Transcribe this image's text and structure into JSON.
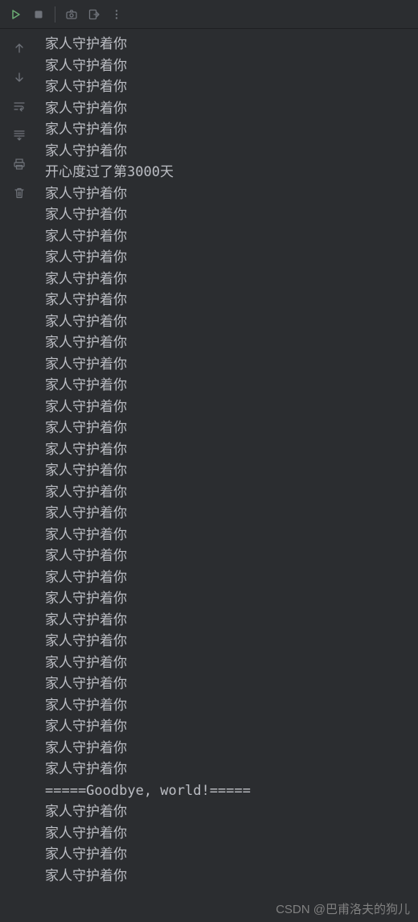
{
  "toolbar": {
    "rerun": "rerun-icon",
    "stop": "stop-icon",
    "screenshot": "screenshot-icon",
    "exit": "exit-icon",
    "more": "more-icon"
  },
  "gutter": {
    "upArrow": "arrow-up-icon",
    "downArrow": "arrow-down-icon",
    "softWrap": "soft-wrap-icon",
    "scrollToEnd": "scroll-to-end-icon",
    "print": "print-icon",
    "delete": "delete-icon"
  },
  "console": {
    "lines": [
      "家人守护着你",
      "家人守护着你",
      "家人守护着你",
      "家人守护着你",
      "家人守护着你",
      "家人守护着你",
      "开心度过了第3000天",
      "家人守护着你",
      "家人守护着你",
      "家人守护着你",
      "家人守护着你",
      "家人守护着你",
      "家人守护着你",
      "家人守护着你",
      "家人守护着你",
      "家人守护着你",
      "家人守护着你",
      "家人守护着你",
      "家人守护着你",
      "家人守护着你",
      "家人守护着你",
      "家人守护着你",
      "家人守护着你",
      "家人守护着你",
      "家人守护着你",
      "家人守护着你",
      "家人守护着你",
      "家人守护着你",
      "家人守护着你",
      "家人守护着你",
      "家人守护着你",
      "家人守护着你",
      "家人守护着你",
      "家人守护着你",
      "家人守护着你",
      "=====Goodbye, world!=====",
      "家人守护着你",
      "家人守护着你",
      "家人守护着你",
      "家人守护着你"
    ]
  },
  "watermark": "CSDN @巴甫洛夫的狗儿",
  "colors": {
    "bg": "#2b2d30",
    "text": "#bcbec4",
    "green": "#6aab73",
    "iconStroke": "#6f737a"
  }
}
